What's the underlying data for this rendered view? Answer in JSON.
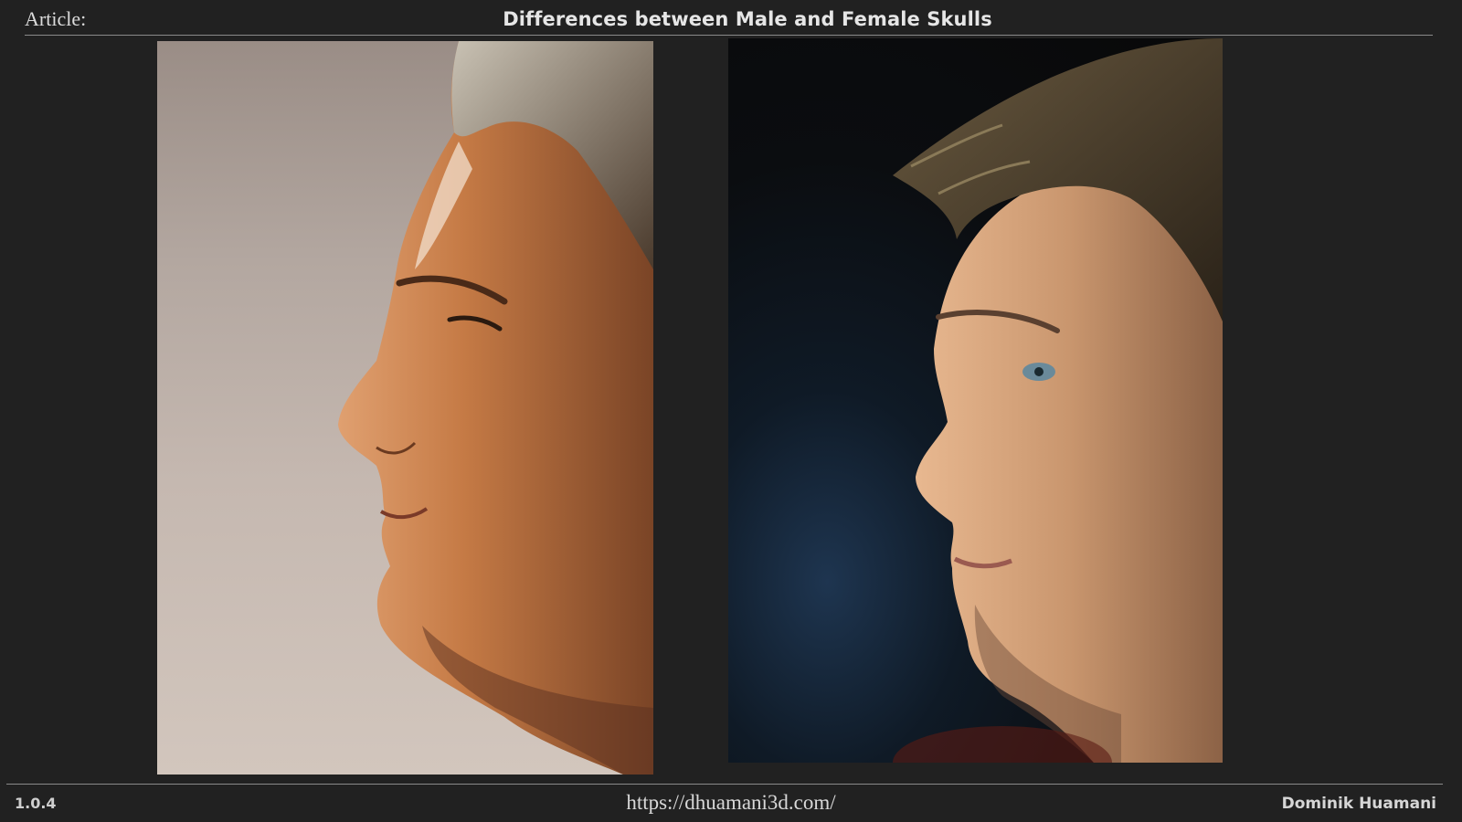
{
  "header": {
    "label": "Article:",
    "title": "Differences between Male and Female Skulls"
  },
  "images": [
    {
      "name": "male-profile-photo-left",
      "facing": "left"
    },
    {
      "name": "male-profile-photo-right",
      "facing": "left"
    }
  ],
  "footer": {
    "version": "1.0.4",
    "url": "https://dhuamani3d.com/",
    "author": "Dominik Huamani"
  },
  "colors": {
    "background": "#212121",
    "text": "#e6e6e6",
    "rule": "#8a8a8a"
  }
}
